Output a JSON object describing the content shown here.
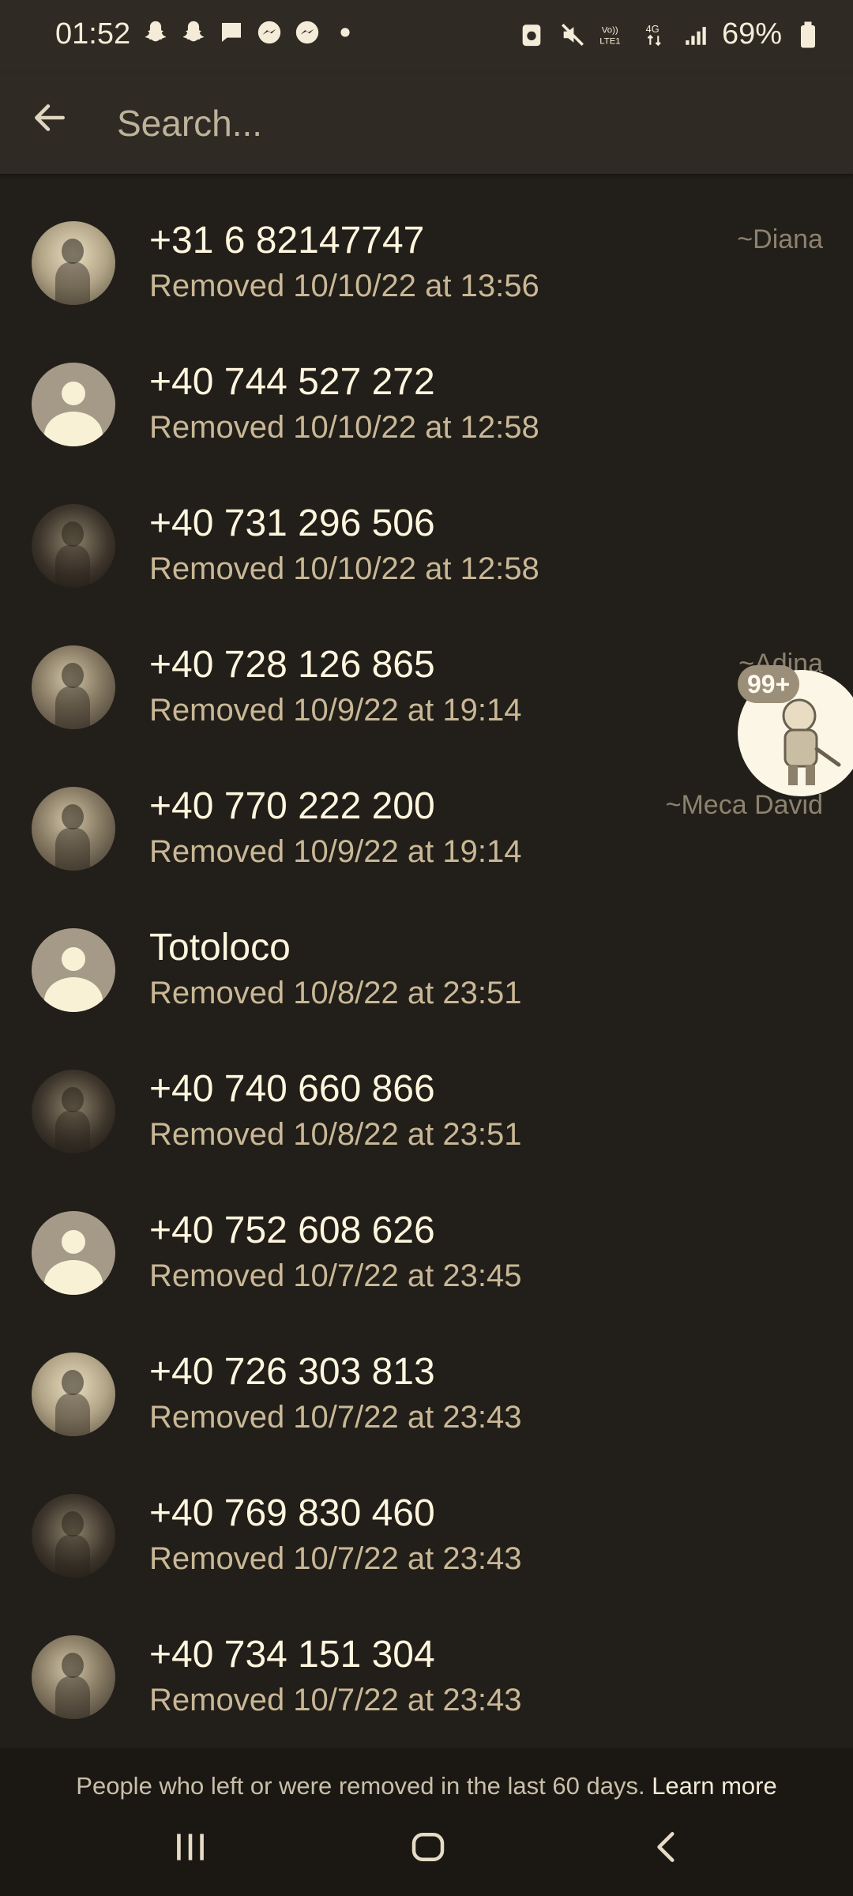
{
  "status": {
    "time": "01:52",
    "battery": "69%",
    "network": "4G"
  },
  "search": {
    "placeholder": "Search..."
  },
  "contacts": [
    {
      "name": "+31 6 82147747",
      "removed": "Removed 10/10/22 at 13:56",
      "tag": "~Diana",
      "avatar": "photo"
    },
    {
      "name": "+40 744 527 272",
      "removed": "Removed 10/10/22 at 12:58",
      "tag": "",
      "avatar": "default"
    },
    {
      "name": "+40 731 296 506",
      "removed": "Removed 10/10/22 at 12:58",
      "tag": "",
      "avatar": "photo"
    },
    {
      "name": "+40 728 126 865",
      "removed": "Removed 10/9/22 at 19:14",
      "tag": "~Adina",
      "avatar": "photo"
    },
    {
      "name": "+40 770 222 200",
      "removed": "Removed 10/9/22 at 19:14",
      "tag": "~Meca David",
      "avatar": "photo"
    },
    {
      "name": "Totoloco",
      "removed": "Removed 10/8/22 at 23:51",
      "tag": "",
      "avatar": "default"
    },
    {
      "name": "+40 740 660 866",
      "removed": "Removed 10/8/22 at 23:51",
      "tag": "",
      "avatar": "photo"
    },
    {
      "name": "+40 752 608 626",
      "removed": "Removed 10/7/22 at 23:45",
      "tag": "",
      "avatar": "default"
    },
    {
      "name": "+40 726 303 813",
      "removed": "Removed 10/7/22 at 23:43",
      "tag": "",
      "avatar": "photo"
    },
    {
      "name": "+40 769 830 460",
      "removed": "Removed 10/7/22 at 23:43",
      "tag": "",
      "avatar": "photo"
    },
    {
      "name": "+40 734 151 304",
      "removed": "Removed 10/7/22 at 23:43",
      "tag": "",
      "avatar": "photo"
    }
  ],
  "chat_head": {
    "badge": "99+"
  },
  "footer": {
    "text": "People who left or were removed in the last 60 days. ",
    "learn_more": "Learn more"
  },
  "colors": {
    "background": "#221e19",
    "appbar": "#2f2a23",
    "primary_text": "#fff6de",
    "secondary_text": "#c9b896"
  }
}
